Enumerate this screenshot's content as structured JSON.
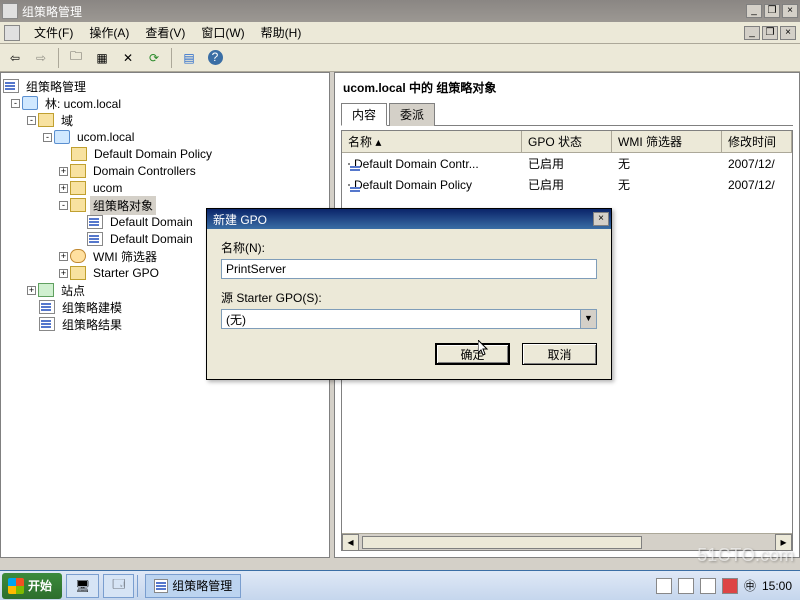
{
  "window": {
    "title": "组策略管理"
  },
  "menu": {
    "file": "文件(F)",
    "action": "操作(A)",
    "view": "查看(V)",
    "window": "窗口(W)",
    "help": "帮助(H)"
  },
  "tree": {
    "root": "组策略管理",
    "forest": "林: ucom.local",
    "domains": "域",
    "domain1": "ucom.local",
    "ddp": "Default Domain Policy",
    "dcs": "Domain Controllers",
    "ucom": "ucom",
    "gpo_container": "组策略对象",
    "gpo1": "Default Domain",
    "gpo2": "Default Domain",
    "wmi": "WMI 筛选器",
    "starter": "Starter GPO",
    "sites": "站点",
    "modeling": "组策略建模",
    "results": "组策略结果"
  },
  "right": {
    "heading": "ucom.local 中的 组策略对象",
    "tab_content": "内容",
    "tab_delegate": "委派",
    "cols": {
      "name": "名称",
      "state": "GPO 状态",
      "wmi": "WMI 筛选器",
      "modified": "修改时间"
    },
    "rows": [
      {
        "name": "Default Domain Contr...",
        "state": "已启用",
        "wmi": "无",
        "modified": "2007/12/"
      },
      {
        "name": "Default Domain Policy",
        "state": "已启用",
        "wmi": "无",
        "modified": "2007/12/"
      }
    ]
  },
  "dialog": {
    "title": "新建 GPO",
    "name_label": "名称(N):",
    "name_value": "PrintServer",
    "source_label": "源 Starter GPO(S):",
    "source_value": "(无)",
    "ok": "确定",
    "cancel": "取消"
  },
  "taskbar": {
    "start": "开始",
    "app": "组策略管理",
    "time": "15:00"
  },
  "watermark": "51CTO.com"
}
